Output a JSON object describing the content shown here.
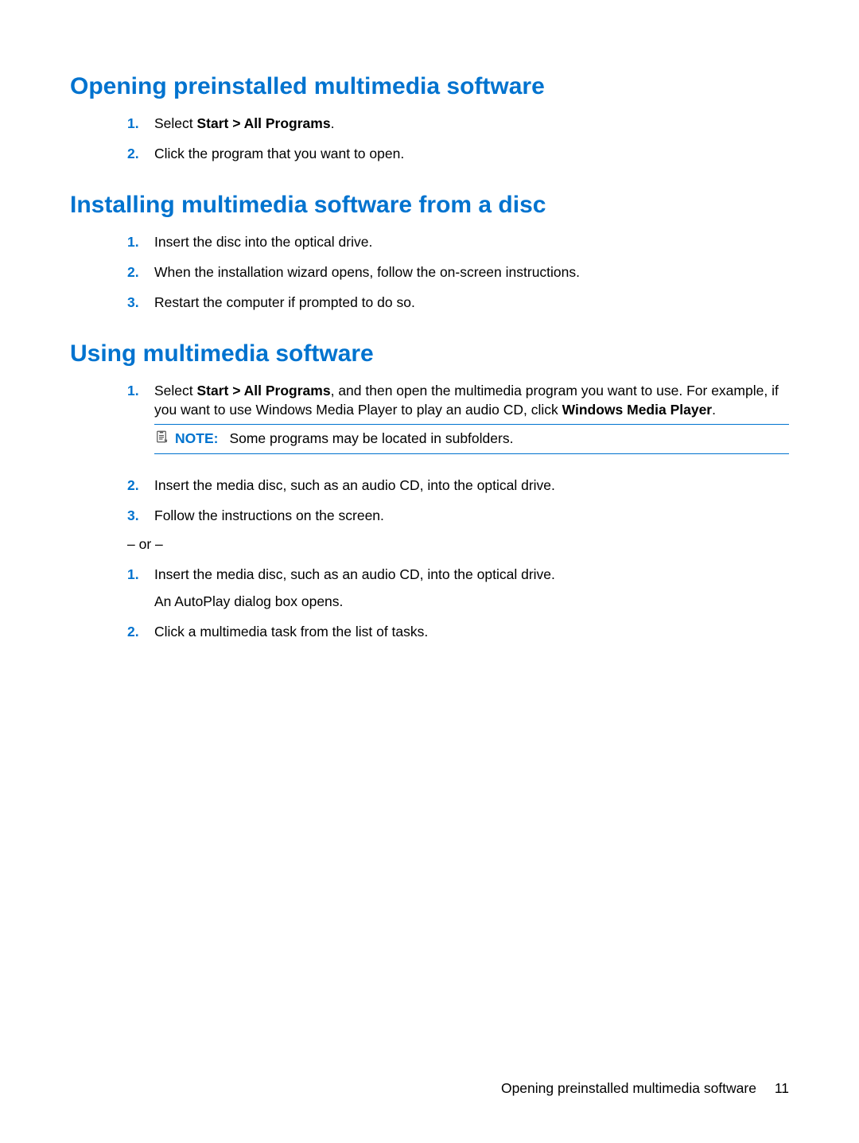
{
  "section1": {
    "heading": "Opening preinstalled multimedia software",
    "items": [
      {
        "num": "1.",
        "pre": "Select ",
        "bold": "Start > All Programs",
        "post": "."
      },
      {
        "num": "2.",
        "text": "Click the program that you want to open."
      }
    ]
  },
  "section2": {
    "heading": "Installing multimedia software from a disc",
    "items": [
      {
        "num": "1.",
        "text": "Insert the disc into the optical drive."
      },
      {
        "num": "2.",
        "text": "When the installation wizard opens, follow the on-screen instructions."
      },
      {
        "num": "3.",
        "text": "Restart the computer if prompted to do so."
      }
    ]
  },
  "section3": {
    "heading": "Using multimedia software",
    "listA": [
      {
        "num": "1.",
        "pre": "Select ",
        "bold1": "Start > All Programs",
        "mid": ", and then open the multimedia program you want to use. For example, if you want to use Windows Media Player to play an audio CD, click ",
        "bold2": "Windows Media Player",
        "post": "."
      },
      {
        "num": "2.",
        "text": "Insert the media disc, such as an audio CD, into the optical drive."
      },
      {
        "num": "3.",
        "text": "Follow the instructions on the screen."
      }
    ],
    "note": {
      "label": "NOTE:",
      "text": "Some programs may be located in subfolders."
    },
    "or": "– or –",
    "listB": [
      {
        "num": "1.",
        "text": "Insert the media disc, such as an audio CD, into the optical drive.",
        "sub": "An AutoPlay dialog box opens."
      },
      {
        "num": "2.",
        "text": "Click a multimedia task from the list of tasks."
      }
    ]
  },
  "footer": {
    "title": "Opening preinstalled multimedia software",
    "page": "11"
  }
}
